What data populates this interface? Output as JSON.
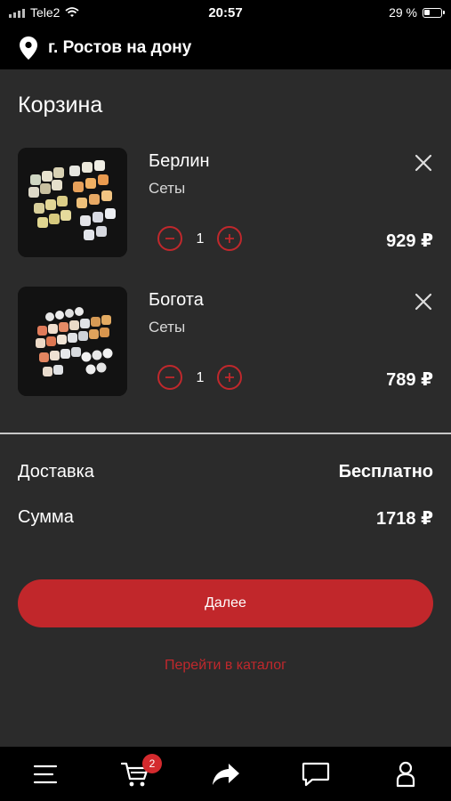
{
  "status_bar": {
    "carrier": "Tele2",
    "time": "20:57",
    "battery_percent": "29 %",
    "battery_level": 0.29
  },
  "location": {
    "city": "г. Ростов на дону",
    "icon": "map-pin-icon"
  },
  "page": {
    "title": "Корзина"
  },
  "cart": {
    "items": [
      {
        "name": "Берлин",
        "category": "Сеты",
        "quantity": "1",
        "price": "929 ₽"
      },
      {
        "name": "Богота",
        "category": "Сеты",
        "quantity": "1",
        "price": "789 ₽"
      }
    ]
  },
  "summary": {
    "delivery_label": "Доставка",
    "delivery_value": "Бесплатно",
    "total_label": "Сумма",
    "total_value": "1718 ₽"
  },
  "actions": {
    "next_label": "Далее",
    "catalog_link": "Перейти в каталог"
  },
  "tab_bar": {
    "cart_badge": "2",
    "icons": [
      "menu-icon",
      "cart-icon",
      "share-icon",
      "chat-icon",
      "profile-icon"
    ]
  },
  "colors": {
    "accent": "#c1272b",
    "background": "#2b2b2b",
    "bar": "#000000"
  }
}
